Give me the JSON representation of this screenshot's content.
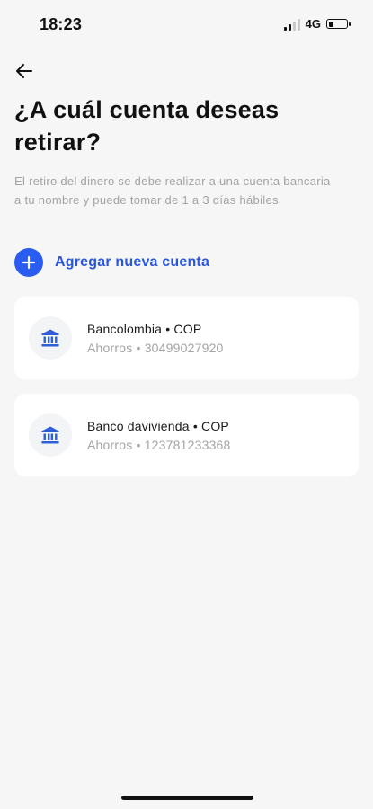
{
  "status_bar": {
    "time": "18:23",
    "network": "4G",
    "battery_level": 0.25,
    "signal_bars": 2
  },
  "icons": {
    "back": "arrow-left-icon",
    "add": "plus-icon",
    "bank": "bank-icon"
  },
  "colors": {
    "accent": "#2a5cf0",
    "accent_text": "#2a56dc",
    "background": "#f6f6f7",
    "card": "#ffffff"
  },
  "header": {
    "title": "¿A cuál cuenta deseas retirar?",
    "description": "El retiro del dinero se debe realizar a una cuenta bancaria a tu nombre y puede tomar de 1 a 3 días hábiles"
  },
  "add_account": {
    "label": "Agregar nueva cuenta"
  },
  "accounts": [
    {
      "name": "Bancolombia • COP",
      "detail": "Ahorros • 30499027920"
    },
    {
      "name": "Banco davivienda • COP",
      "detail": "Ahorros • 123781233368"
    }
  ]
}
